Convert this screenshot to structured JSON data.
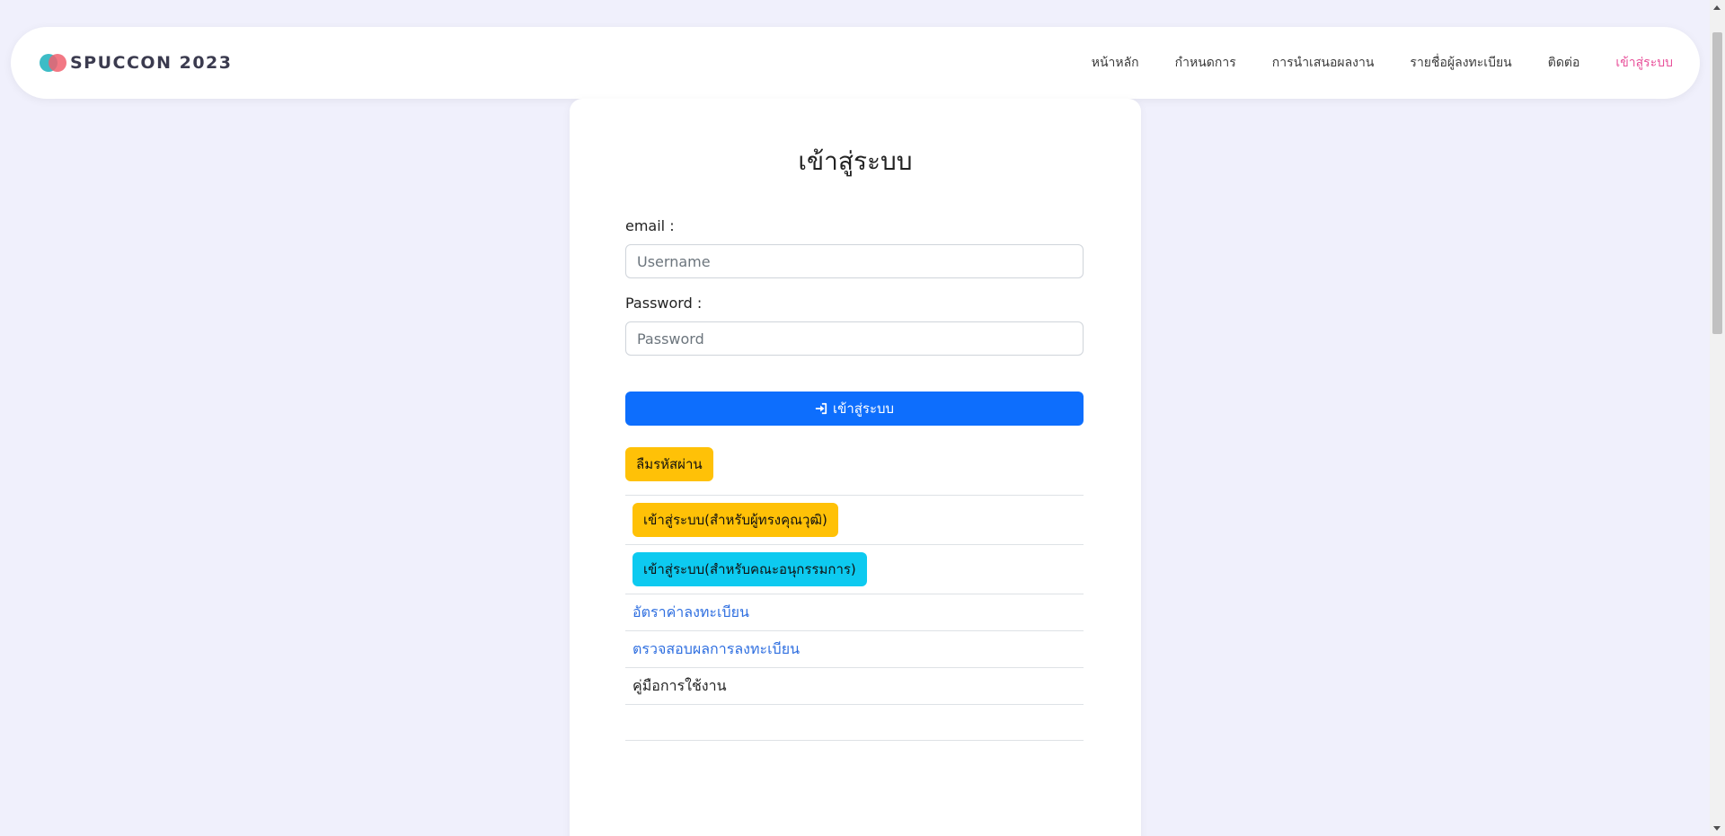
{
  "brand": {
    "name": "SPUCCON 2023"
  },
  "nav": {
    "items": [
      {
        "label": "หน้าหลัก"
      },
      {
        "label": "กำหนดการ"
      },
      {
        "label": "การนำเสนอผลงาน"
      },
      {
        "label": "รายชื่อผู้ลงทะเบียน"
      },
      {
        "label": "ติดต่อ"
      },
      {
        "label": "เข้าสู่ระบบ",
        "active": true
      }
    ]
  },
  "login": {
    "title": "เข้าสู่ระบบ",
    "email_label": "email :",
    "email_placeholder": "Username",
    "password_label": "Password :",
    "password_placeholder": "Password",
    "submit_label": "เข้าสู่ระบบ",
    "forgot_label": "ลืมรหัสผ่าน"
  },
  "links": {
    "expert_login": "เข้าสู่ระบบ(สำหรับผู้ทรงคุณวุฒิ)",
    "committee_login": "เข้าสู่ระบบ(สำหรับคณะอนุกรรมการ)",
    "registration_rate": "อัตราค่าลงทะเบียน",
    "check_registration": "ตรวจสอบผลการลงทะเบียน",
    "manual": "คู่มือการใช้งาน"
  },
  "colors": {
    "background": "#f0f0fc",
    "primary": "#0d6efd",
    "warning": "#ffc107",
    "info": "#0dcaf0",
    "active_nav": "#e8509a",
    "link": "#2f6fe0"
  }
}
